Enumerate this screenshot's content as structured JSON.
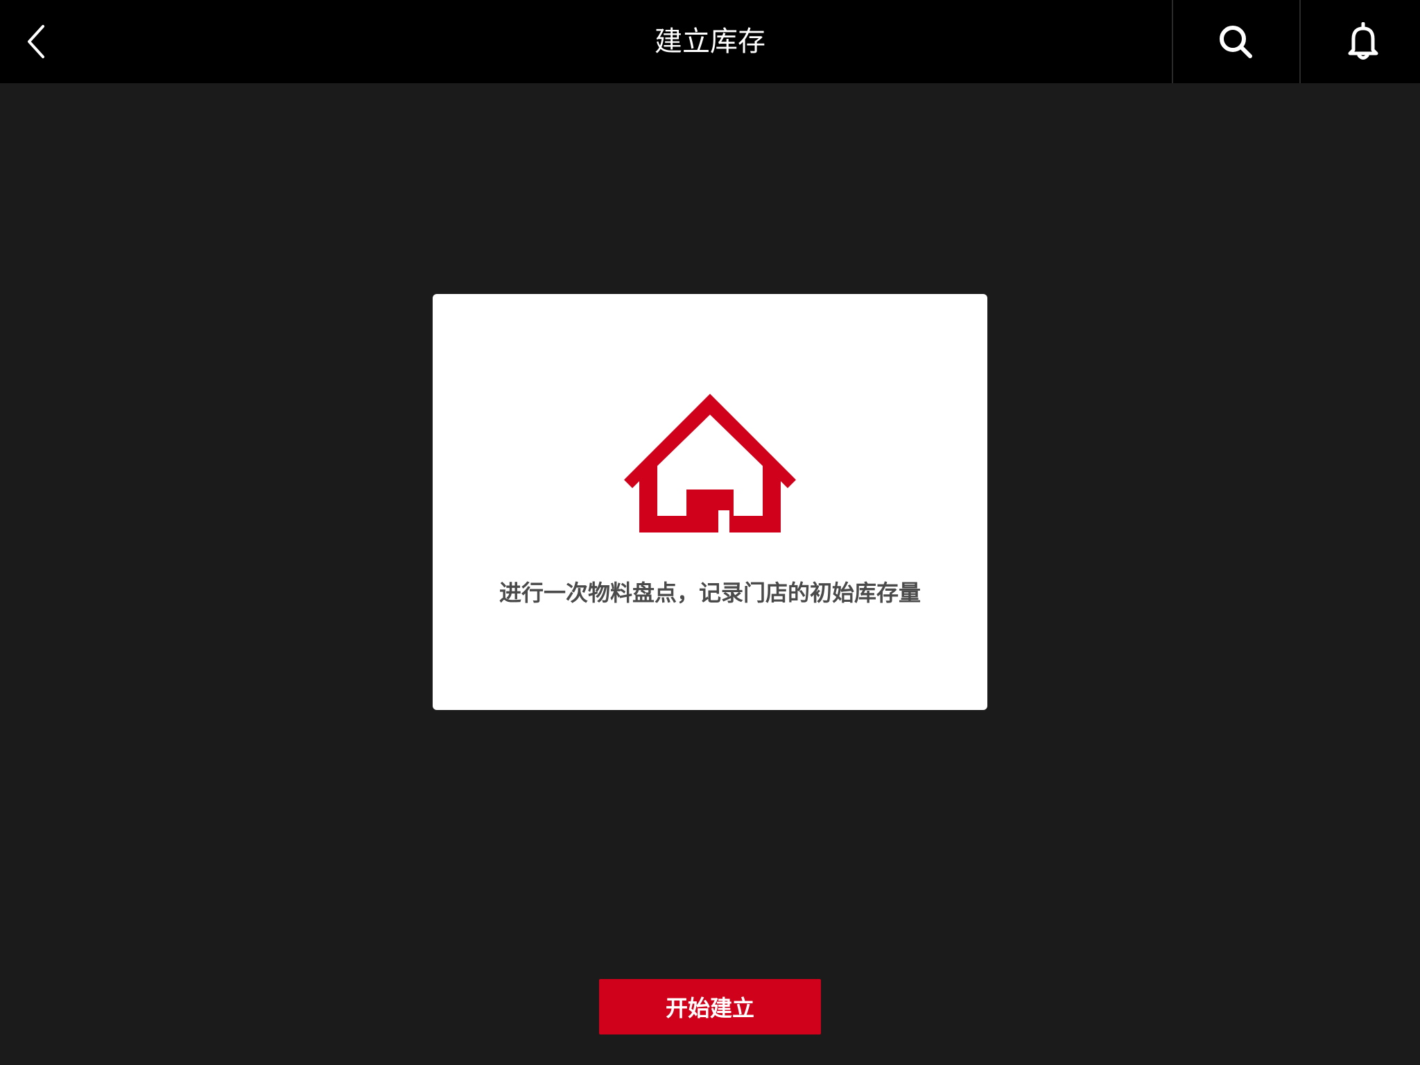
{
  "header": {
    "title": "建立库存",
    "back_icon": "chevron-left-icon",
    "search_icon": "search-icon",
    "bell_icon": "bell-icon"
  },
  "card": {
    "icon": "house-icon",
    "description": "进行一次物料盘点，记录门店的初始库存量"
  },
  "actions": {
    "start_label": "开始建立"
  },
  "colors": {
    "header_bg": "#000000",
    "page_bg": "#1b1b1b",
    "accent": "#d0021b",
    "card_bg": "#ffffff",
    "text_gray": "#4a4a4a"
  }
}
